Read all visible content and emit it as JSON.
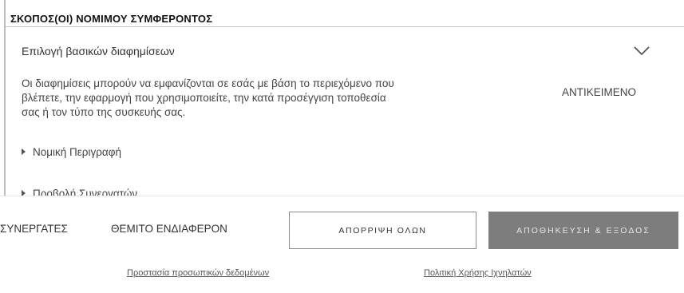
{
  "section": {
    "title": "ΣΚΟΠΟΣ(ΟΙ) ΝΟΜΙΜΟΥ ΣΥΜΦΕΡΟΝΤΟΣ"
  },
  "purpose": {
    "title": "Επιλογή βασικών διαφημίσεων",
    "description_lines": [
      "Οι διαφημίσεις μπορούν να εμφανίζονται σε εσάς με βάση το περιεχόμενο που",
      "βλέπετε, την εφαρμογή που χρησιμοποιείτε, την κατά προσέγγιση τοποθεσία",
      "σας ή τον τύπο της συσκευής σας."
    ],
    "object_label": "ΑΝΤΙΚΕΙΜΕΝΟ",
    "legal_description": "Νομική Περιγραφή",
    "view_partners": "Προβολή Συνεργατών"
  },
  "footer": {
    "partners_link": "ΣΥΝΕΡΓΑΤΕΣ",
    "legitimate_interest_link": "ΘΕΜΙΤΟ ΕΝΔΙΑΦΕΡΟΝ",
    "reject_all_button": "ΑΠΟΡΡΙΨΗ ΟΛΩΝ",
    "save_exit_button": "ΑΠΟΘΗΚΕΥΣΗ & ΕΞΟΔΟΣ",
    "privacy_link": "Προστασία προσωπικών δεδομένων",
    "cookie_policy_link": "Πολιτική Χρήσης Ιχνηλατών"
  },
  "icons": {
    "expand": "chevron-down-icon",
    "collapsed_section": "triangle-right-icon"
  },
  "colors": {
    "save_button_bg": "#7d7d7d",
    "reject_button_border": "#8a8a8a",
    "title": "#111111",
    "text": "#444444"
  }
}
